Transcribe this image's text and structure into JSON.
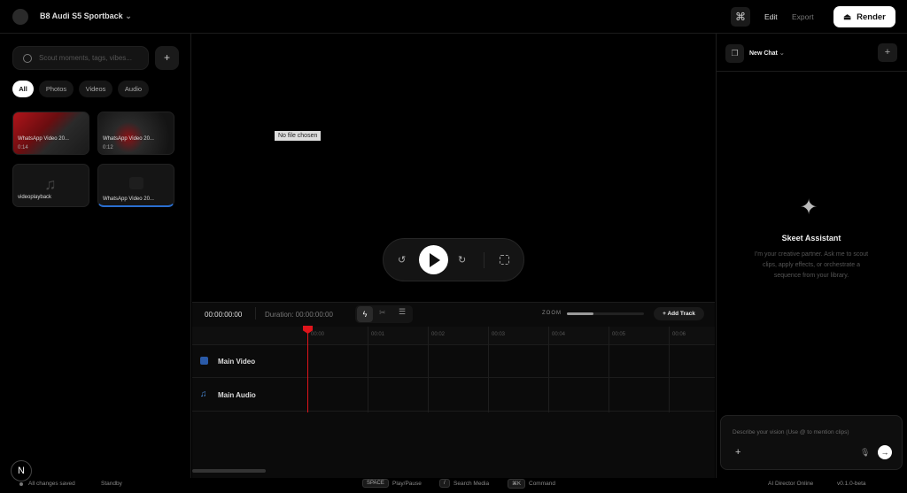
{
  "header": {
    "project": "B8 Audi S5 Sportback",
    "edit": "Edit",
    "export": "Export",
    "render": "Render"
  },
  "library": {
    "search_placeholder": "Scout moments, tags, vibes...",
    "filters": [
      "All",
      "Photos",
      "Videos",
      "Audio"
    ],
    "active_filter": "All",
    "items": [
      {
        "title": "WhatsApp Video 20...",
        "duration": "0:14"
      },
      {
        "title": "WhatsApp Video 20...",
        "duration": "0:12"
      },
      {
        "title": "videoplayback"
      },
      {
        "title": "WhatsApp Video 20..."
      }
    ]
  },
  "preview": {
    "no_file": "No file chosen"
  },
  "timeline": {
    "timecode": "00:00:00:00",
    "duration": "Duration: 00:00:00:00",
    "zoom_label": "ZOOM",
    "zoom_level": 0.35,
    "add_track": "+ Add Track",
    "ruler": [
      "00:00",
      "00:01",
      "00:02",
      "00:03",
      "00:04",
      "00:05",
      "00:06"
    ],
    "tracks": [
      "Main Video",
      "Main Audio"
    ],
    "playhead_color": "#e0141b"
  },
  "chat": {
    "title": "New Chat",
    "assistant_name": "Skeet Assistant",
    "intro": "I'm your creative partner. Ask me to scout clips, apply effects, or orchestrate a sequence from your library.",
    "input_placeholder": "Describe your vision (Use @ to mention clips)"
  },
  "status": {
    "saved": "All changes saved",
    "state": "Standby",
    "shortcuts": [
      {
        "key": "SPACE",
        "label": "Play/Pause"
      },
      {
        "key": "/",
        "label": "Search Media"
      },
      {
        "key": "⌘K",
        "label": "Command"
      }
    ],
    "director": "AI Director Online",
    "version": "v0.1.0-beta"
  }
}
